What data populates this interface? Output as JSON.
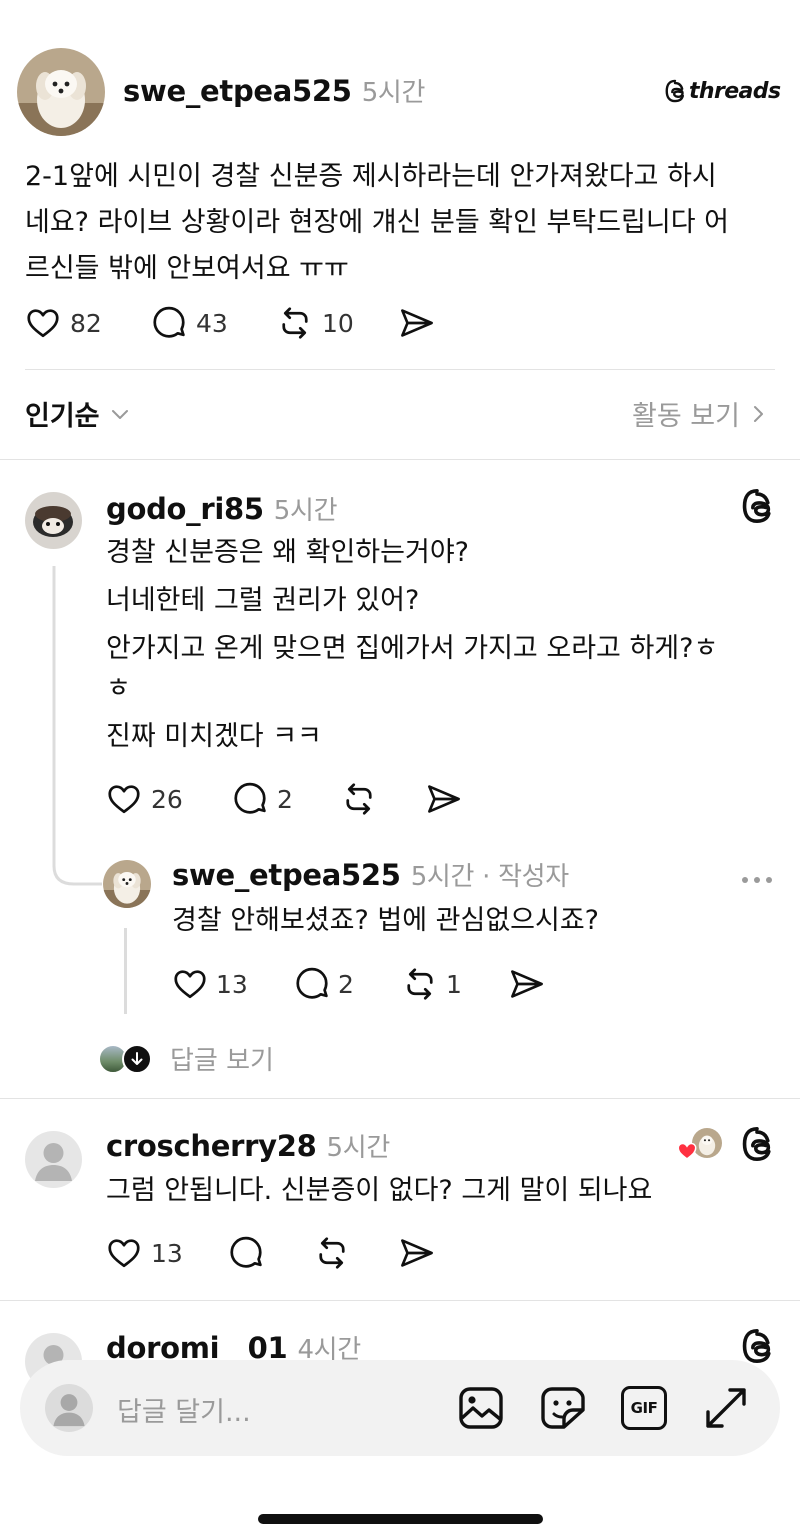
{
  "post": {
    "username": "swe_etpea525",
    "time": "5시간",
    "brand": "threads",
    "text_lines": [
      "2-1앞에 시민이 경찰 신분증 제시하라는데 안가져왔다고 하시",
      "네요? 라이브 상황이라 현장에 걔신 분들 확인 부탁드립니다 어",
      "르신들 밖에 안보여서요 ㅠㅠ"
    ],
    "likes": "82",
    "comments": "43",
    "reposts": "10"
  },
  "sort": {
    "label": "인기순",
    "activity": "활동 보기"
  },
  "comments": [
    {
      "username": "godo_ri85",
      "time": "5시간",
      "lines": [
        "경찰 신분증은 왜 확인하는거야?",
        "너네한테 그럴 권리가 있어?",
        "안가지고 온게 맞으면 집에가서 가지고 오라고 하게?ㅎ",
        "ㅎ",
        "진짜 미치겠다 ㅋㅋ"
      ],
      "likes": "26",
      "comments": "2",
      "reply": {
        "username": "swe_etpea525",
        "time": "5시간 · 작성자",
        "text": "경찰 안해보셨죠? 법에 관심없으시죠?",
        "likes": "13",
        "comments": "2",
        "reposts": "1"
      },
      "view_replies": "답글 보기"
    },
    {
      "username": "croscherry28",
      "time": "5시간",
      "text": "그럼 안됩니다. 신분증이 없다? 그게 말이 되나요",
      "likes": "13"
    },
    {
      "username": "doromi__01",
      "time": "4시간"
    }
  ],
  "composer": {
    "placeholder": "답글 달기...",
    "gif_label": "GIF"
  },
  "colors": {
    "heart_red": "#ff3040",
    "text_primary": "#101010",
    "text_secondary": "#9a9a9a"
  }
}
